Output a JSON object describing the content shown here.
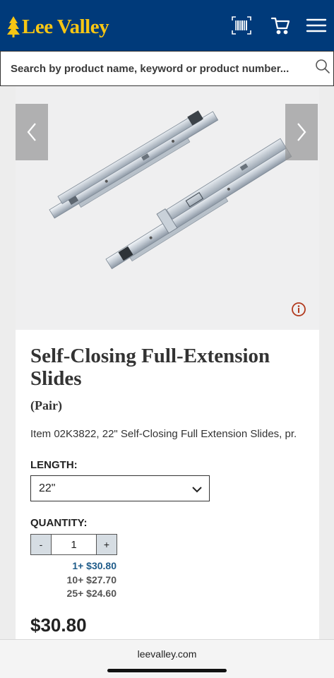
{
  "header": {
    "logo_text": "Lee Valley",
    "icons": [
      "barcode-scan-icon",
      "cart-icon",
      "hamburger-menu-icon"
    ],
    "brand_color": "#003a7a",
    "logo_color": "#f7c614"
  },
  "search": {
    "placeholder": "Search by product name, keyword or product number..."
  },
  "product": {
    "title": "Self-Closing Full-Extension Slides",
    "subtitle": "(Pair)",
    "item_description": "Item 02K3822, 22\" Self-Closing Full Extension Slides, pr.",
    "length_label": "LENGTH:",
    "length_value": "22\"",
    "quantity_label": "QUANTITY:",
    "quantity_minus": "-",
    "quantity_value": "1",
    "quantity_plus": "+",
    "price_tiers": [
      "1+ $30.80",
      "10+ $27.70",
      "25+ $24.60"
    ],
    "price": "$30.80"
  },
  "browser": {
    "url": "leevalley.com"
  }
}
